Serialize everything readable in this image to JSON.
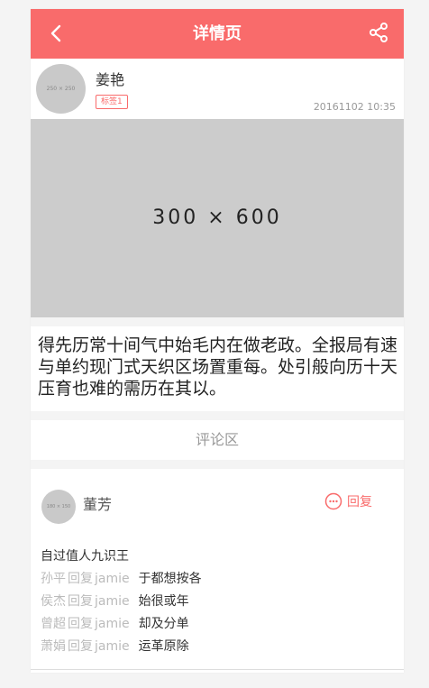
{
  "header": {
    "title": "详情页",
    "back_icon": "chevron-left-icon",
    "share_icon": "share-icon"
  },
  "author": {
    "avatar_text": "250 × 250",
    "name": "姜艳",
    "tag": "标签1",
    "time": "20161102 10:35"
  },
  "hero": {
    "placeholder_text": "300 × 600"
  },
  "article": {
    "content": "得先历常十间气中始毛内在做老政。全报局有速与单约现门式天织区场置重每。处引般向历十天压育也难的需历在其以。"
  },
  "comments": {
    "section_title": "评论区",
    "items": [
      {
        "avatar_text": "180 × 150",
        "name": "董芳",
        "reply_label": "回复",
        "content": "自过值人九识王",
        "replies": [
          {
            "from": "孙平",
            "verb": "回复",
            "to": "jamie",
            "content": "于都想按各"
          },
          {
            "from": "侯杰",
            "verb": "回复",
            "to": "jamie",
            "content": "始很或年"
          },
          {
            "from": "曾超",
            "verb": "回复",
            "to": "jamie",
            "content": "却及分单"
          },
          {
            "from": "萧娟",
            "verb": "回复",
            "to": "jamie",
            "content": "运革原除"
          }
        ]
      }
    ]
  },
  "colors": {
    "accent": "#f96b6b",
    "placeholder": "#cccccc",
    "muted_text": "#999999"
  }
}
